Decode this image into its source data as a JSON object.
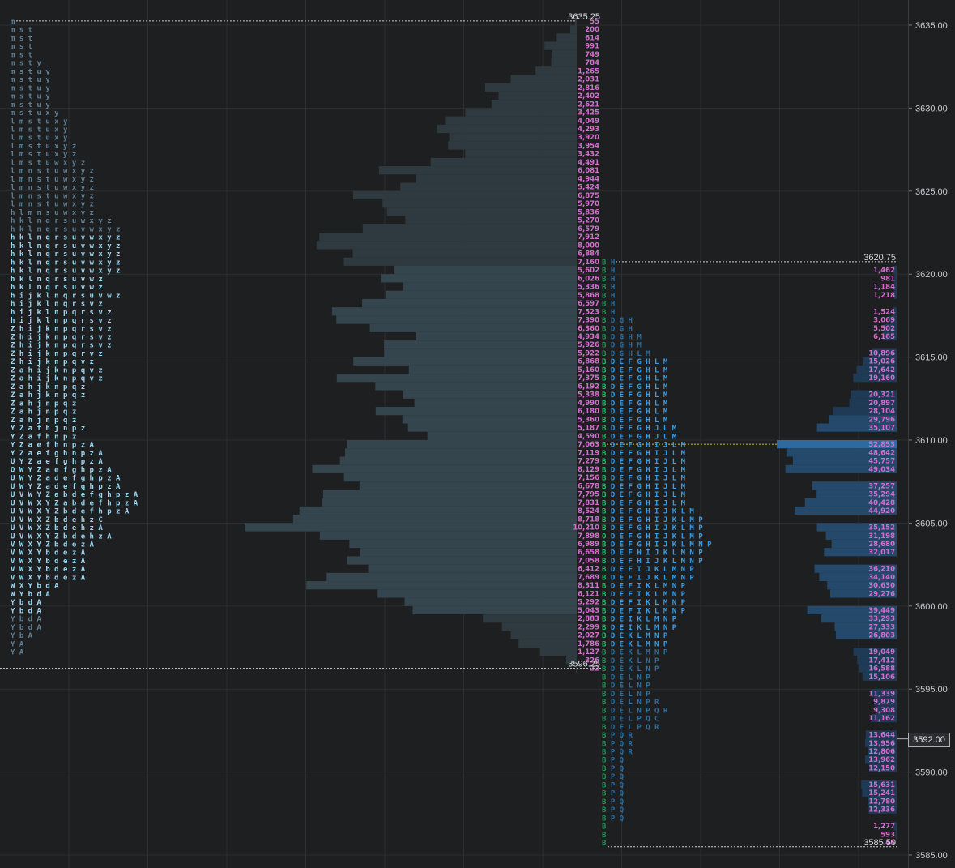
{
  "chart_data": {
    "type": "market-profile",
    "price_axis": {
      "ylim": [
        3584.25,
        3636.25
      ],
      "ticks": [
        "3635.00",
        "3630.00",
        "3625.00",
        "3620.00",
        "3615.00",
        "3610.00",
        "3605.00",
        "3600.00",
        "3595.00",
        "3590.00",
        "3585.00"
      ],
      "tick_values": [
        3635,
        3630,
        3625,
        3620,
        3615,
        3610,
        3605,
        3600,
        3595,
        3590,
        3585
      ],
      "current_price": "3592.00",
      "current_value": 3592
    },
    "profiles": [
      {
        "name": "profile-1",
        "high_label": "3635.25",
        "high": 3635.25,
        "low_label": "3596.25",
        "low": 3596.25,
        "poc": 3605,
        "volumes": [
          "55",
          "200",
          "614",
          "991",
          "749",
          "784",
          "1,265",
          "2,031",
          "2,816",
          "2,402",
          "2,621",
          "3,425",
          "4,049",
          "4,293",
          "3,920",
          "3,954",
          "3,432",
          "4,491",
          "6,081",
          "4,944",
          "5,424",
          "6,875",
          "5,970",
          "5,836",
          "5,270",
          "6,579",
          "7,912",
          "8,000",
          "6,884",
          "7,160",
          "5,602",
          "6,026",
          "5,336",
          "5,868",
          "6,597",
          "7,523",
          "7,390",
          "6,360",
          "4,934",
          "5,926",
          "5,922",
          "6,868",
          "5,160",
          "7,375",
          "6,192",
          "5,338",
          "4,990",
          "6,180",
          "5,360",
          "5,187",
          "4,590",
          "7,063",
          "7,119",
          "7,279",
          "8,129",
          "7,156",
          "6,678",
          "7,795",
          "7,831",
          "8,524",
          "8,718",
          "10,210",
          "7,898",
          "6,989",
          "6,658",
          "7,058",
          "6,412",
          "7,689",
          "8,311",
          "6,121",
          "5,292",
          "5,043",
          "2,883",
          "2,299",
          "2,027",
          "1,786",
          "1,127",
          "326",
          "22"
        ],
        "tpo_rows": [
          "m",
          "m s t",
          "m s t",
          "m s t",
          "m s t",
          "m s t y",
          "m s t u y",
          "m s t u y",
          "m s t u y",
          "m s t u y",
          "m s t u y",
          "m s t u x y",
          "l m s t u x y",
          "l m s t u x y",
          "l m s t u x y",
          "l m s t u x y z",
          "l m s t u x y z",
          "l m s t u w x y z",
          "l m n s t u w x y z",
          "l m n s t u w x y z",
          "l m n s t u w x y z",
          "l m n s t u w x y z",
          "l m n s t u w x y z",
          "h l m n s u w x y z",
          "h k l n q r s u w x y z",
          "h k l n q r s u v w x y z",
          "h k l n q r s u v w x y z",
          "h k l n q r s u v w x y z",
          "h k l n q r s u v w x y z",
          "h k l n q r s u v w x y z",
          "h k l n q r s u v w x y z",
          "h k l n q r s u v w z",
          "h k l n q r s u v w z",
          "h i j k l n q r s u v w z",
          "h i j k l n q r s v z",
          "h i j k l n p q r s v z",
          "h i j k l n p q r s v z",
          "Z h i j k n p q r s v z",
          "Z h i j k n p q r s v z",
          "Z h i j k n p q r s v z",
          "Z h i j k n p q r v z",
          "Z h i j k n p q v z",
          "Z a h i j k n p q v z",
          "Z a h i j k n p q v z",
          "Z a h j k n p q z",
          "Z a h j k n p q z",
          "Z a h j n p q z",
          "Z a h j n p q z",
          "Z a h j n p q z",
          "Y Z a f h j n p z",
          "Y Z a f h n p z",
          "Y Z a e f h n p z A",
          "Y Z a e f g h n p z A",
          "U Y Z a e f g h p z A",
          "O W Y Z a e f g h p z A",
          "U W Y Z a d e f g h p z A",
          "U W Y Z a d e f g h p z A",
          "U V W Y Z a b d e f g h p z A",
          "U V W X Y Z a b d e f h p z A",
          "U V W X Y Z b d e f h p z A",
          "U V W X Z b d e h z C",
          "U V W X Z b d e h z A",
          "U V W X Y Z b d e h z A",
          "V W X Y Z b d e z A",
          "V W X Y b d e z A",
          "V W X Y b d e z A",
          "V W X Y b d e z A",
          "V W X Y b d e z A",
          "W X Y b d A",
          "W Y b d A",
          "Y b d A",
          "Y b d A",
          "Y b d A",
          "Y b d A",
          "Y b A",
          "Y A",
          "Y A"
        ]
      },
      {
        "name": "profile-2",
        "high_label": "3620.75",
        "high": 3620.75,
        "low_label": "3585.50",
        "low": 3585.5,
        "poc": 3609.75,
        "volumes": [
          "",
          "1,462",
          "981",
          "1,184",
          "1,218",
          "",
          "1,524",
          "3,069",
          "5,502",
          "6,165",
          "",
          "10,896",
          "15,026",
          "17,642",
          "19,160",
          "",
          "20,321",
          "20,897",
          "28,104",
          "29,796",
          "35,107",
          "",
          "52,853",
          "48,642",
          "45,757",
          "49,034",
          "",
          "37,257",
          "35,294",
          "40,428",
          "44,920",
          "",
          "35,152",
          "31,198",
          "28,680",
          "32,017",
          "",
          "36,210",
          "34,140",
          "30,630",
          "29,276",
          "",
          "39,449",
          "33,293",
          "27,333",
          "26,803",
          "",
          "19,049",
          "17,412",
          "16,588",
          "15,106",
          "",
          "11,339",
          "9,879",
          "9,308",
          "11,162",
          "",
          "13,644",
          "13,956",
          "12,806",
          "13,962",
          "12,150",
          "",
          "15,631",
          "15,241",
          "12,780",
          "12,336",
          "",
          "1,277",
          "593",
          "45"
        ],
        "tpo_rows": [
          "B H",
          "B H",
          "B H",
          "B H",
          "B H",
          "B H",
          "B H",
          "B D G H",
          "B D G H",
          "B D G H M",
          "B D G H M",
          "B D G H L M",
          "B D E F G H L M",
          "B D E F G H L M",
          "B D E F G H L M",
          "B D E F G H L M",
          "B D E F G H L M",
          "B D E F G H L M",
          "B D E F G H L M",
          "B D E F G H L M",
          "B D E F G H J L M",
          "B D E F G H J L M",
          "B D E F G H I J L M",
          "B D E F G H I J L M",
          "B D E F G H I J L M",
          "B D E F G H I J L M",
          "B D E F G H I J L M",
          "B D E F G H I J L M",
          "B D E F G H I J L M",
          "B D E F G H I J L M",
          "B D E F G H I J K L M",
          "B D E F G H I J K L M P",
          "B D E F G H I J K L M P",
          "O D E F G H I J K L M P",
          "B D E F G H I J K L M N P",
          "B D E F H I J K L M N P",
          "B D E F H I J K L M N P",
          "B D E F I J K L M N P",
          "B D E F I J K L M N P",
          "B D E F I K L M N P",
          "B D E F I K L M N P",
          "B D E F I K L M N P",
          "B D E F I K L M N P",
          "B D E I K L M N P",
          "B D E I K L M N P",
          "B D E K L M N P",
          "B D E K L M N P",
          "B D E K L M N P",
          "B D E K L N P",
          "B D E K L N P",
          "B D E L N P",
          "B D E L N P",
          "B D E L N P",
          "B D E L N P R",
          "B D E L N P Q R",
          "B D E L P Q C",
          "B D E L P Q R",
          "B P Q R",
          "B P Q R",
          "B P Q R",
          "B P Q",
          "B P Q",
          "B P Q",
          "B P Q",
          "B P Q",
          "B P Q",
          "B P Q",
          "B P Q",
          "B",
          "B",
          "B"
        ]
      }
    ]
  },
  "colors": {
    "background": "#1e1f21",
    "grid": "#2c2e31",
    "profile1_bar": "#2e3a40",
    "profile1_va": "#34454d",
    "profile1_poc": "#4a6472",
    "profile2_bar": "#1f3a55",
    "profile2_va": "#25496b",
    "profile2_poc": "#2e6aa0",
    "volume_text": "#d36fd0",
    "tpo_dim": "#5f7f93",
    "tpo_bright": "#9ad7f2",
    "tpo_poc": "#f1c40f",
    "tpo2_blue": "#3b9be0",
    "tpo2_green": "#2fb36b",
    "poc_line": "#d6c02a",
    "level_line": "#d0d0d0"
  }
}
